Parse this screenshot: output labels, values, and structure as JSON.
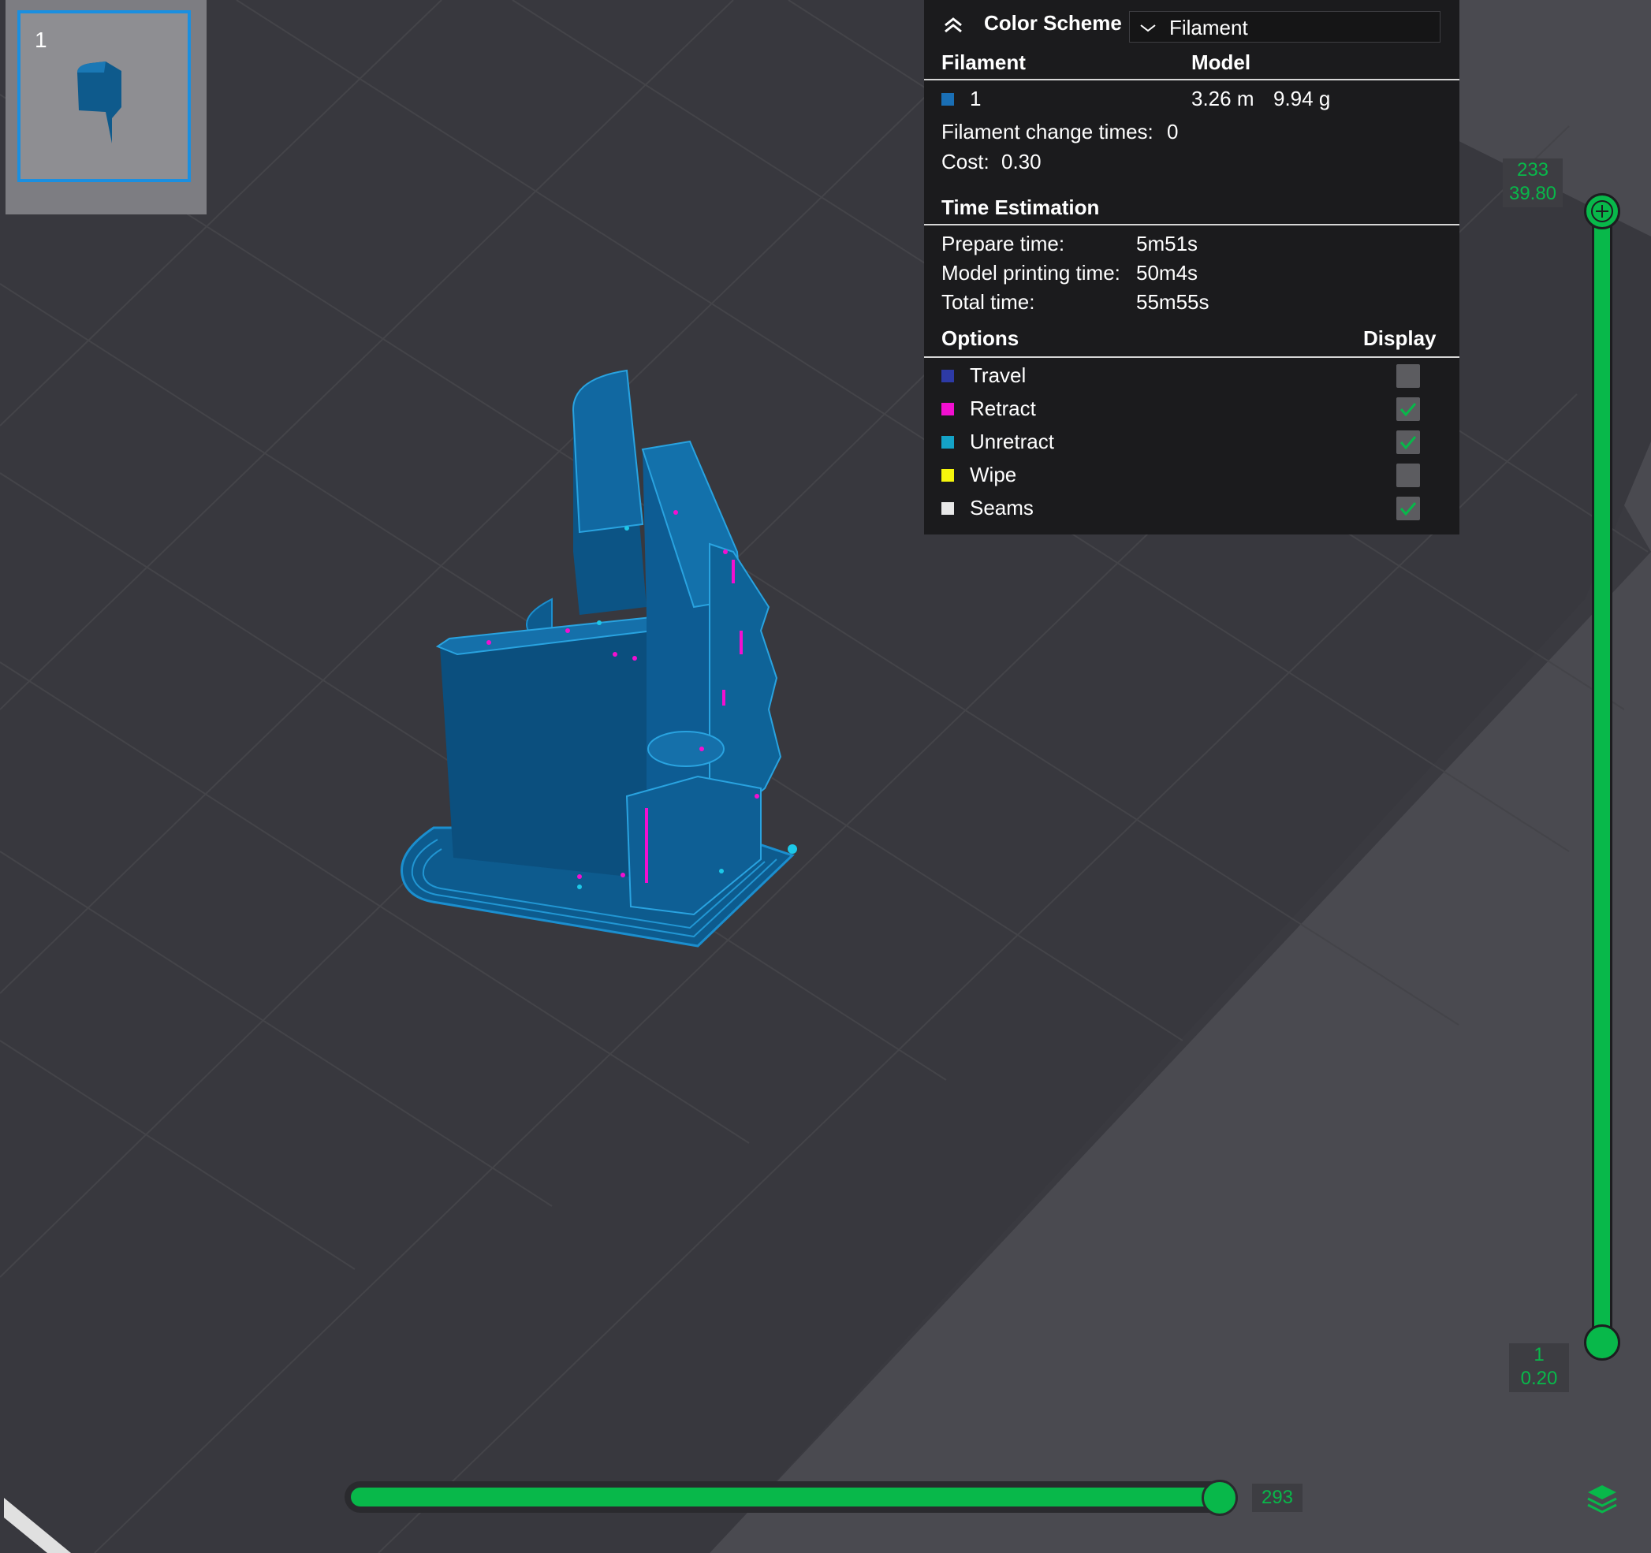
{
  "plate": {
    "number": "1"
  },
  "legend": {
    "color_scheme_label": "Color Scheme",
    "color_scheme_value": "Filament",
    "col_filament": "Filament",
    "col_model": "Model",
    "filament_row": {
      "id": "1",
      "length": "3.26 m",
      "weight": "9.94 g",
      "color": "#1a6fb5"
    },
    "change_times_label": "Filament change times:",
    "change_times_value": "0",
    "cost_label": "Cost:",
    "cost_value": "0.30",
    "time_header": "Time Estimation",
    "prepare_label": "Prepare time:",
    "prepare_value": "5m51s",
    "model_print_label": "Model printing time:",
    "model_print_value": "50m4s",
    "total_label": "Total time:",
    "total_value": "55m55s",
    "options_header": "Options",
    "display_header": "Display",
    "options": [
      {
        "label": "Travel",
        "color": "#2d3aa6",
        "checked": false
      },
      {
        "label": "Retract",
        "color": "#f20fd0",
        "checked": true
      },
      {
        "label": "Unretract",
        "color": "#14a3c7",
        "checked": true
      },
      {
        "label": "Wipe",
        "color": "#f5f50c",
        "checked": false
      },
      {
        "label": "Seams",
        "color": "#e8e8e8",
        "checked": true
      }
    ]
  },
  "vslider": {
    "top_layer": "233",
    "top_height": "39.80",
    "bottom_layer": "1",
    "bottom_height": "0.20"
  },
  "hslider": {
    "value": "293"
  },
  "colors": {
    "accent": "#08b84a",
    "model": "#0e5a8c",
    "panel": "#1b1b1d",
    "bed": "#3a3a40"
  }
}
